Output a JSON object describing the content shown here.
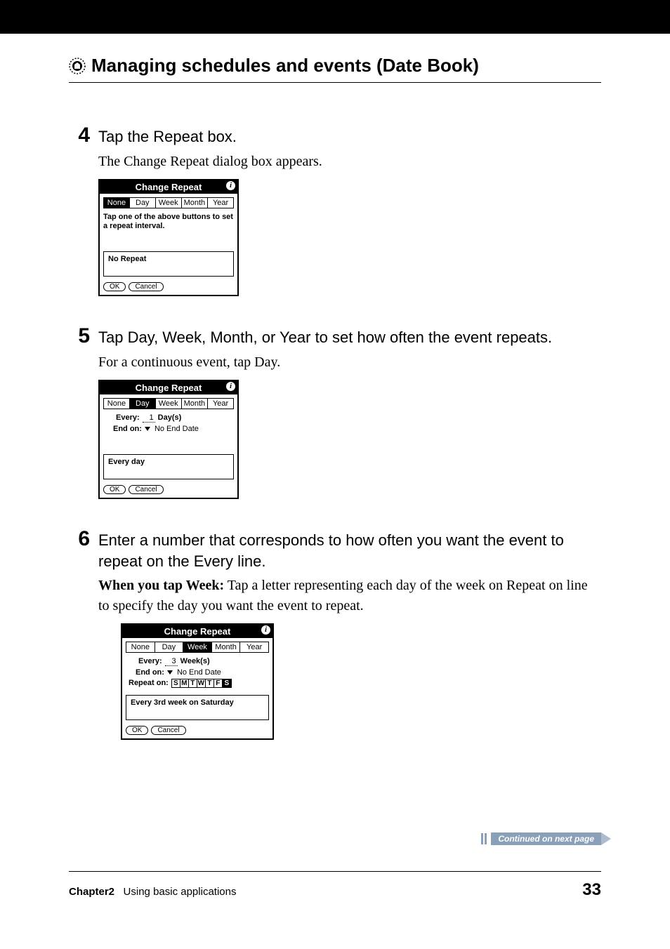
{
  "header": {
    "title": "Managing schedules and events (Date Book)"
  },
  "steps": {
    "s4": {
      "num": "4",
      "instruction": "Tap the Repeat box.",
      "desc": "The Change Repeat dialog box appears."
    },
    "s5": {
      "num": "5",
      "instruction": "Tap Day, Week, Month, or Year to set how often the event repeats.",
      "desc": "For a continuous event, tap Day."
    },
    "s6": {
      "num": "6",
      "instruction": "Enter a number that corresponds to how often you want the event to repeat on the Every line.",
      "desc_bold": "When you tap Week:",
      "desc_rest": " Tap a letter representing each day of the week on Repeat on line to specify the day you want the event to repeat."
    }
  },
  "dialog1": {
    "title": "Change Repeat",
    "tabs": {
      "none": "None",
      "day": "Day",
      "week": "Week",
      "month": "Month",
      "year": "Year"
    },
    "help": "Tap one of the above buttons to set a repeat interval.",
    "summary": "No Repeat",
    "ok": "OK",
    "cancel": "Cancel"
  },
  "dialog2": {
    "title": "Change Repeat",
    "tabs": {
      "none": "None",
      "day": "Day",
      "week": "Week",
      "month": "Month",
      "year": "Year"
    },
    "every_label": "Every:",
    "every_value": "1",
    "every_unit": "Day(s)",
    "endon_label": "End on:",
    "endon_value": "No End Date",
    "summary": "Every day",
    "ok": "OK",
    "cancel": "Cancel"
  },
  "dialog3": {
    "title": "Change Repeat",
    "tabs": {
      "none": "None",
      "day": "Day",
      "week": "Week",
      "month": "Month",
      "year": "Year"
    },
    "every_label": "Every:",
    "every_value": "3",
    "every_unit": "Week(s)",
    "endon_label": "End on:",
    "endon_value": "No End Date",
    "repeaton_label": "Repeat on:",
    "days": {
      "d0": "S",
      "d1": "M",
      "d2": "T",
      "d3": "W",
      "d4": "T",
      "d5": "F",
      "d6": "S"
    },
    "summary": "Every 3rd week on Saturday",
    "ok": "OK",
    "cancel": "Cancel"
  },
  "continued": "Continued on next page",
  "footer": {
    "chapter": "Chapter2",
    "subtitle": "Using basic applications",
    "page": "33"
  }
}
